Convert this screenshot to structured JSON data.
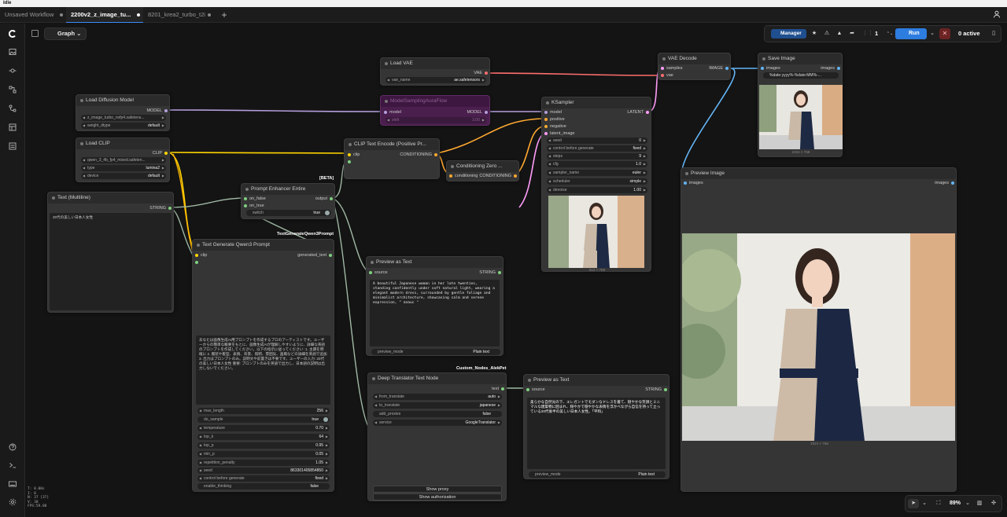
{
  "window": {
    "title": "Idle"
  },
  "tabs": [
    {
      "label": "Unsaved Workflow"
    },
    {
      "label": "2200v2_z_image_tu..."
    },
    {
      "label": "8201_krea2_turbo_t2i"
    }
  ],
  "graph": {
    "label": "Graph"
  },
  "toolbar": {
    "manager_label": "Manager",
    "queue_count": "1",
    "run_label": "Run",
    "active_label": "0 active",
    "zoom": "89%"
  },
  "status_lines": [
    "T: 0.00s",
    "I: 0",
    "N: 37 [37]",
    "V: 38",
    "FPS:59.88"
  ],
  "colors": {
    "model": "#b39ddb",
    "clip": "#ffd500",
    "vae": "#ff6e6e",
    "conditioning": "#ffa931",
    "latent": "#ff9cf9",
    "image": "#64b5f6",
    "string": "#7fd07f"
  },
  "nodes": {
    "load_diffusion": {
      "title": "Load Diffusion Model",
      "out": "MODEL",
      "unet_name": "z_image_turbo_nvfp4.safetens...",
      "weight_dtype_label": "weight_dtype",
      "weight_dtype": "default"
    },
    "load_clip": {
      "title": "Load CLIP",
      "out": "CLIP",
      "clip_name": "qwen_3_4b_fp4_mixed.safeten...",
      "type_label": "type",
      "type": "lumina2",
      "device_label": "device",
      "device": "default"
    },
    "load_vae": {
      "title": "Load VAE",
      "out": "VAE",
      "vae_name_label": "vae_name",
      "vae_name": "ae.safetensors"
    },
    "model_sampling": {
      "title": "ModelSamplingAuraFlow",
      "in": "model",
      "out": "MODEL",
      "shift_label": "shift",
      "shift": "3.00"
    },
    "clip_encode": {
      "title": "CLIP Text Encode (Positive Pr...",
      "in_clip": "clip",
      "in_text": "text",
      "out": "CONDITIONING"
    },
    "cond_zero": {
      "title": "Conditioning Zero ...",
      "in": "conditioning",
      "out": "CONDITIONING"
    },
    "ksampler": {
      "title": "KSampler",
      "in_model": "model",
      "in_pos": "positive",
      "in_neg": "negative",
      "in_latent": "latent_image",
      "out": "LATENT",
      "widgets": [
        {
          "label": "seed",
          "value": "0"
        },
        {
          "label": "control before generate",
          "value": "fixed"
        },
        {
          "label": "steps",
          "value": "9"
        },
        {
          "label": "cfg",
          "value": "1.0"
        },
        {
          "label": "sampler_name",
          "value": "euler"
        },
        {
          "label": "scheduler",
          "value": "simple"
        },
        {
          "label": "denoise",
          "value": "1.00"
        }
      ],
      "dim": "512 × 768"
    },
    "vae_decode": {
      "title": "VAE Decode",
      "in_samples": "samples",
      "in_vae": "vae",
      "out": "IMAGE"
    },
    "save_image": {
      "title": "Save Image",
      "in": "images",
      "out": "images",
      "prefix": "%date:yyyy%-%date:MM%-...",
      "dim": "1024 × 768"
    },
    "preview_image": {
      "title": "Preview Image",
      "in": "images",
      "out": "images",
      "dim": "1024 × 768"
    },
    "text_multiline": {
      "title": "Text (Multiline)",
      "out": "STRING",
      "text": "20代の美しい日本人女性"
    },
    "prompt_enhancer": {
      "title": "Prompt Enhancer Entire",
      "in_false": "on_false",
      "in_true": "on_true",
      "out": "output",
      "switch_label": "switch",
      "switch": "true",
      "badge": "[BETA]"
    },
    "text_generate": {
      "group": "TextGenerateQwen3Prompt",
      "title": "Text Generate Qwen3 Prompt",
      "in": "clip",
      "out": "generated_text",
      "prompt": "あなたは画像生成AI用プロンプトを作成するプロのアーティストです。ユーザーからの簡単な概要をもとに、画像生成AIが理解しやすいように、詳細な英語のプロンプトを作成してください。以下の指示に従ってください: 1. 主題を明確に 2. 服装や髪型、表情、背景、照明、雰囲気、画風などの詳細を英語で追加 3. 出力はプロンプトのみ。説明文や前置きは不要です。ユーザーの入力: 20代の美しい日本人女性 重要: プロンプトのみを英語で出力し、日本語の説明は出力しないでください。",
      "widgets": [
        {
          "label": "max_length",
          "value": "256"
        },
        {
          "label": "do_sample",
          "value": "true"
        },
        {
          "label": "temperature",
          "value": "0.70"
        },
        {
          "label": "top_k",
          "value": "64"
        },
        {
          "label": "top_p",
          "value": "0.95"
        },
        {
          "label": "min_p",
          "value": "0.05"
        },
        {
          "label": "repetition_penalty",
          "value": "1.05"
        },
        {
          "label": "seed",
          "value": "863301405854850"
        },
        {
          "label": "control before generate",
          "value": "fixed"
        },
        {
          "label": "enable_thinking",
          "value": "false"
        }
      ]
    },
    "preview_text_1": {
      "title": "Preview as Text",
      "in": "source",
      "out": "STRING",
      "text": "A beautiful Japanese woman in her late twenties, standing confidently under soft natural light, wearing a elegant modern dress, surrounded by gentle foliage and minimalist architecture, showcasing calm and serene expression, \" anauc \"",
      "mode_label": "preview_mode",
      "mode": "Plain text"
    },
    "deep_translator": {
      "group": "Custom_Nodes_AlekPet",
      "title": "Deep Translator Text Node",
      "out": "text",
      "widgets": [
        {
          "label": "from_translate",
          "value": "auto"
        },
        {
          "label": "to_translate",
          "value": "japanese"
        },
        {
          "label": "add_proxies",
          "value": "false"
        },
        {
          "label": "service",
          "value": "GoogleTranslator"
        }
      ],
      "btn_proxy": "Show proxy",
      "btn_auth": "Show authorization"
    },
    "preview_text_2": {
      "title": "Preview as Text",
      "in": "source",
      "out": "STRING",
      "text": "柔らかな自然光の下、エレガントでモダンなドレスを着て、穏やかな笑顔とミニマルな建築物に囲まれ、穏やかで穏やかな表情を浮かべながら自信を持って立っている20代後半の美しい日本人女性。「平和」",
      "mode_label": "preview_mode",
      "mode": "Plain text"
    }
  }
}
